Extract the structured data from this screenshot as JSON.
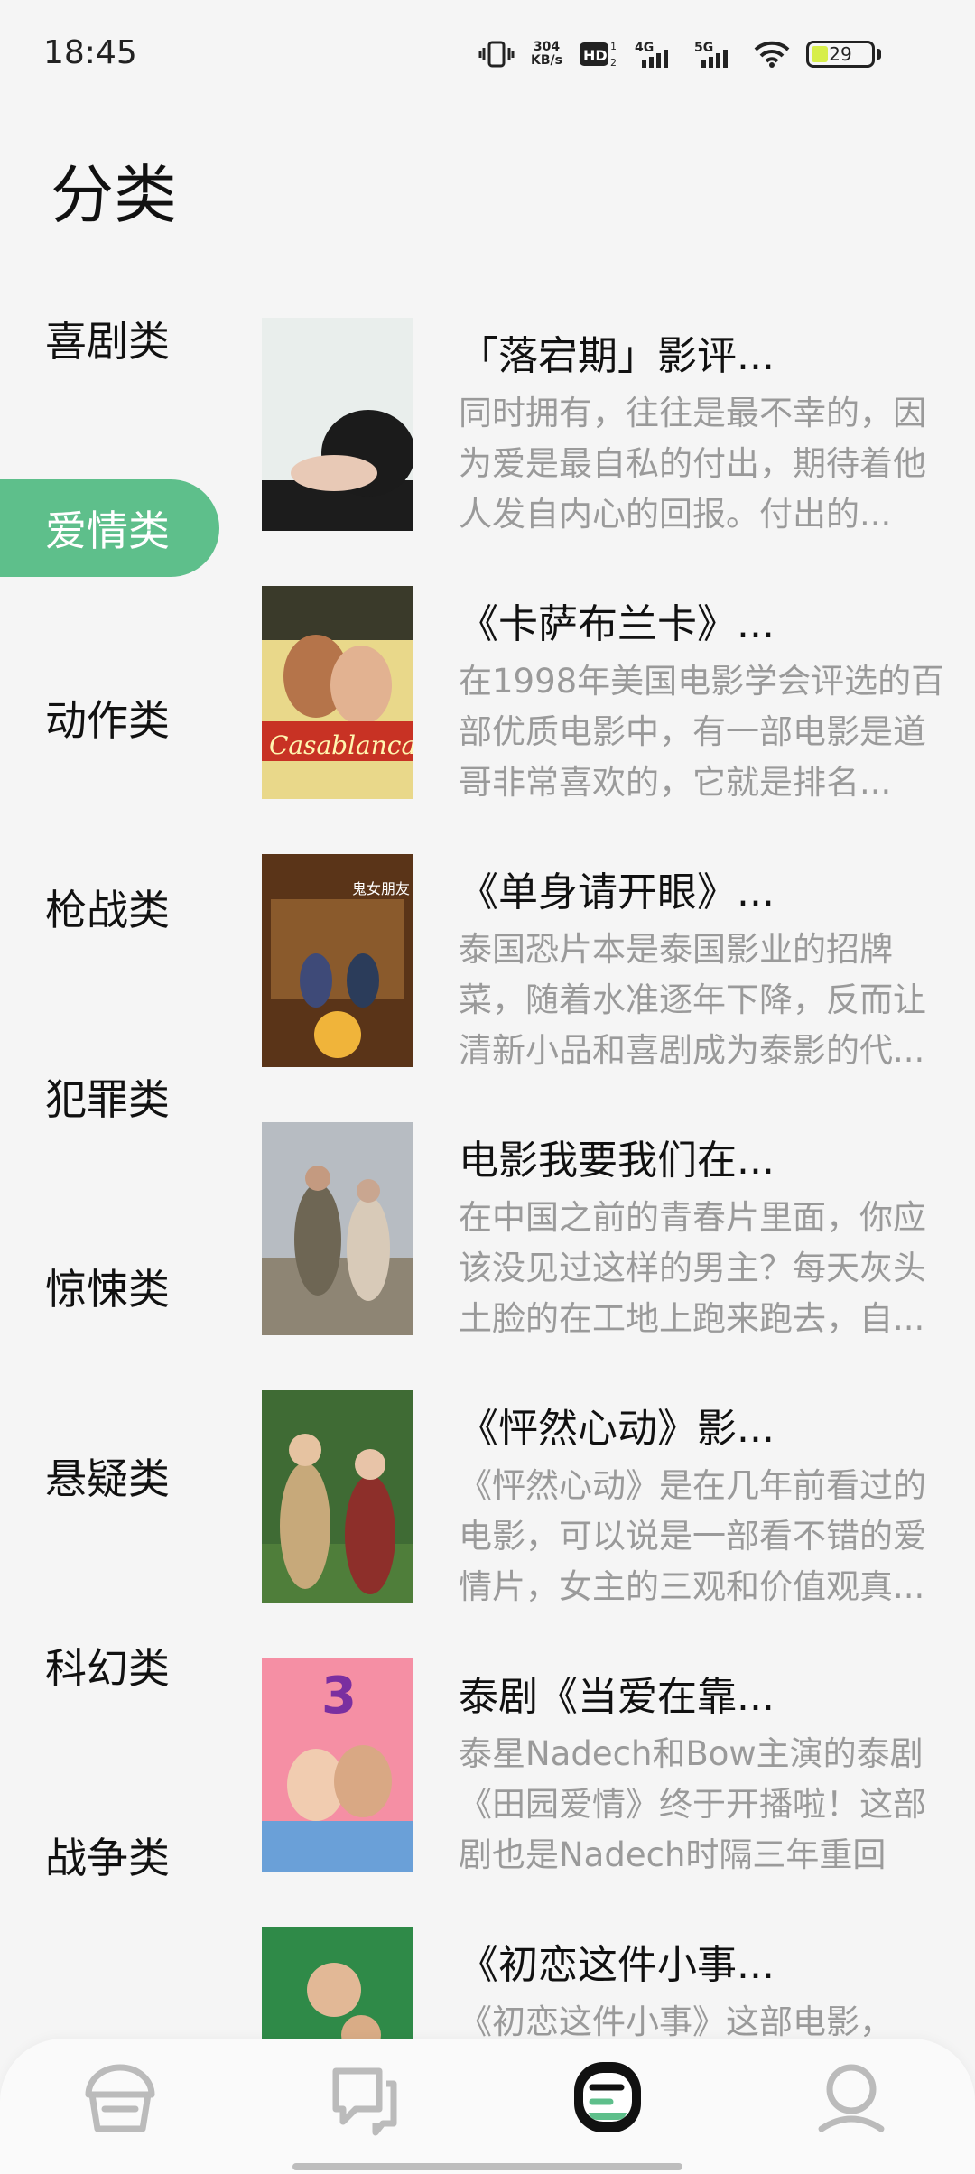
{
  "status": {
    "time": "18:45",
    "speed": "304",
    "speed_unit": "KB/s",
    "hd": "HD",
    "net1": "4G",
    "net2": "5G",
    "battery": "29"
  },
  "page": {
    "title": "分类"
  },
  "categories": [
    {
      "label": "喜剧类"
    },
    {
      "label": "爱情类"
    },
    {
      "label": "动作类"
    },
    {
      "label": "枪战类"
    },
    {
      "label": "犯罪类"
    },
    {
      "label": "惊悚类"
    },
    {
      "label": "悬疑类"
    },
    {
      "label": "科幻类"
    },
    {
      "label": "战争类"
    }
  ],
  "active_category": "爱情类",
  "articles": [
    {
      "title": "「落宕期」影评...",
      "desc": "同时拥有，往往是最不幸的，因为爱是最自私的付出，期待着他人发自内心的回报。付出的...",
      "poster_label": ""
    },
    {
      "title": "《卡萨布兰卡》...",
      "desc": "在1998年美国电影学会评选的百部优质电影中，有一部电影是道哥非常喜欢的，它就是排名...",
      "poster_label": "Casablanca"
    },
    {
      "title": "《单身请开眼》...",
      "desc": "泰国恐片本是泰国影业的招牌菜，随着水准逐年下降，反而让清新小品和喜剧成为泰影的代...",
      "poster_label": "鬼女朋友"
    },
    {
      "title": "电影我要我们在...",
      "desc": "在中国之前的青春片里面，你应该没见过这样的男主？每天灰头土脸的在工地上跑来跑去，自...",
      "poster_label": ""
    },
    {
      "title": "《怦然心动》影...",
      "desc": "《怦然心动》是在几年前看过的电影，可以说是一部看不错的爱情片，女主的三观和价值观真...",
      "poster_label": ""
    },
    {
      "title": "泰剧《当爱在靠...",
      "desc": "泰星Nadech和Bow主演的泰剧《田园爱情》终于开播啦！这部剧也是Nadech时隔三年重回电...",
      "poster_label": "3"
    },
    {
      "title": "《初恋这件小事...",
      "desc": "《初恋这件小事》这部电影，就...",
      "poster_label": ""
    }
  ],
  "tabs": [
    {
      "icon": "home-icon"
    },
    {
      "icon": "chat-icon"
    },
    {
      "icon": "category-icon",
      "active": true
    },
    {
      "icon": "profile-icon"
    }
  ],
  "colors": {
    "accent": "#5ebf8b",
    "desc": "#9a9a9a"
  }
}
